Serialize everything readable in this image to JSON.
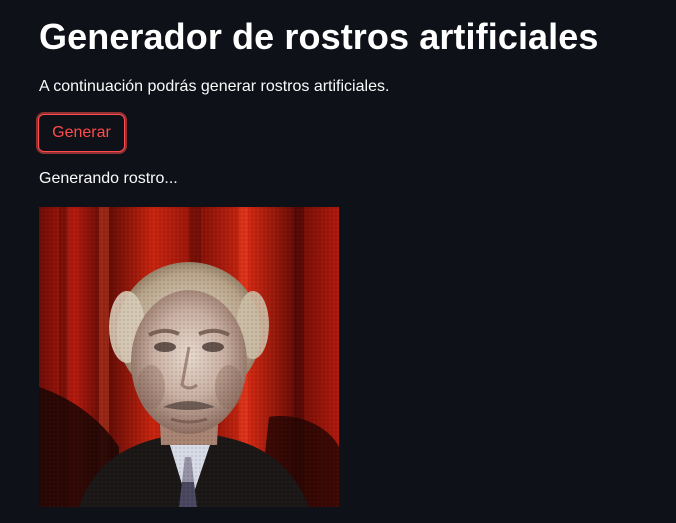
{
  "app": {
    "title": "Generador de rostros artificiales",
    "intro": "A continuación podrás generar rostros artificiales.",
    "button_label": "Generar",
    "status": "Generando rostro..."
  },
  "colors": {
    "background": "#0e1117",
    "text": "#fafafa",
    "accent": "#ff4b4b"
  },
  "image": {
    "kind": "generated-face-photo"
  }
}
